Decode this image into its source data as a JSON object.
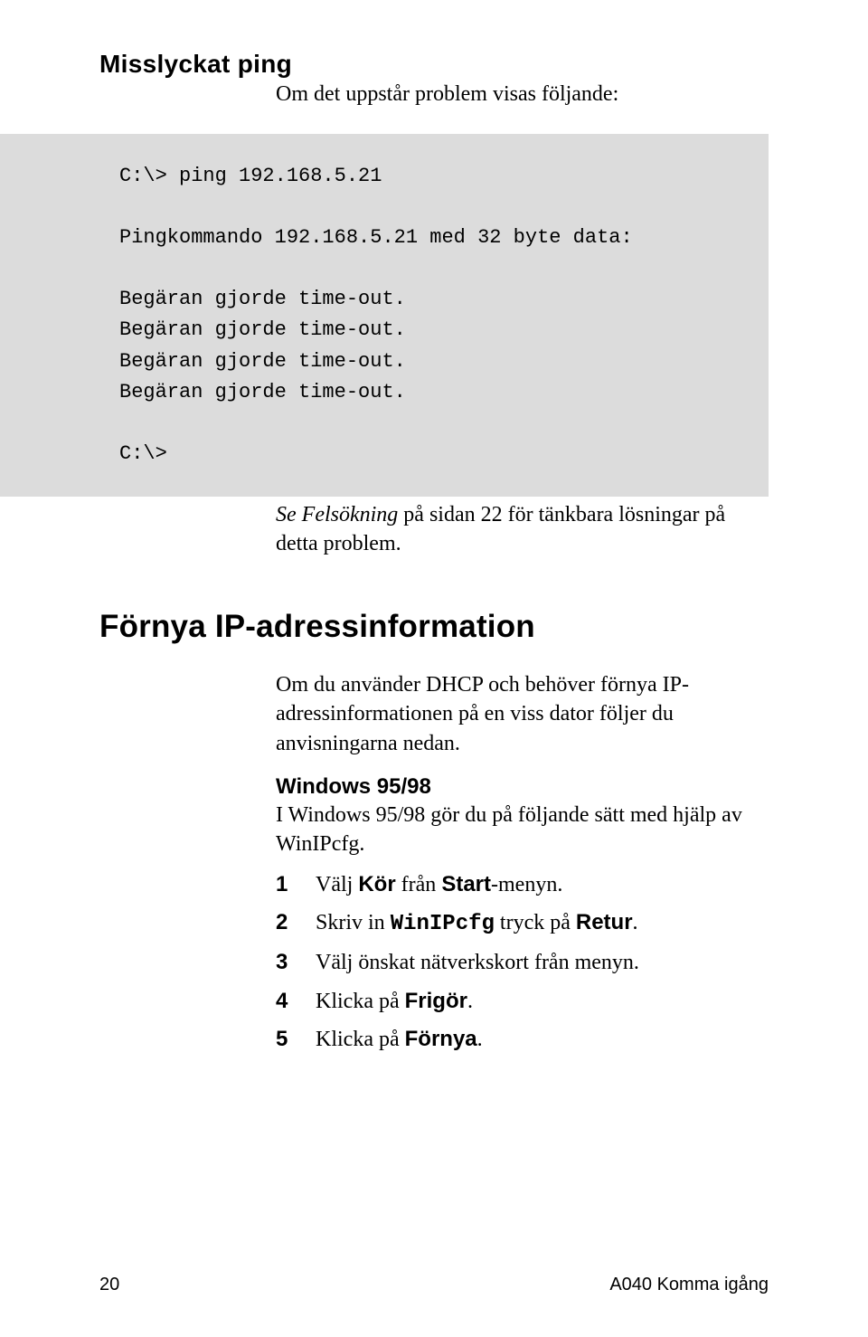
{
  "section1": {
    "heading": "Misslyckat ping",
    "intro": "Om det uppstår problem visas följande:"
  },
  "code": {
    "line1": "C:\\> ping 192.168.5.21",
    "line2": "Pingkommando 192.168.5.21 med 32 byte data:",
    "line3": "Begäran gjorde time-out.",
    "line4": "Begäran gjorde time-out.",
    "line5": "Begäran gjorde time-out.",
    "line6": "Begäran gjorde time-out.",
    "line7": "C:\\>"
  },
  "postcode": {
    "pre": "Se ",
    "italic": "Felsökning",
    "post": " på sidan 22 för tänkbara lösningar på detta problem."
  },
  "section2": {
    "heading": "Förnya IP-adressinformation",
    "para": "Om du använder DHCP och behöver förnya IP-adressinformationen på en viss dator följer du anvisningarna nedan.",
    "subheading": "Windows 95/98",
    "subpara": "I Windows 95/98 gör du på följande sätt med hjälp av WinIPcfg."
  },
  "steps": [
    {
      "num": "1",
      "pre": "Välj ",
      "b1": "Kör",
      "mid": " från ",
      "b2": "Start",
      "post": "-menyn."
    },
    {
      "num": "2",
      "pre": "Skriv in ",
      "mono": "WinIPcfg",
      "mid": " tryck på ",
      "b1": "Retur",
      "post": "."
    },
    {
      "num": "3",
      "pre": "Välj önskat nätverkskort från menyn.",
      "b1": "",
      "mid": "",
      "post": ""
    },
    {
      "num": "4",
      "pre": "Klicka på ",
      "b1": "Frigör",
      "mid": "",
      "post": "."
    },
    {
      "num": "5",
      "pre": "Klicka på ",
      "b1": "Förnya",
      "mid": "",
      "post": "."
    }
  ],
  "footer": {
    "page": "20",
    "label": "A040 Komma igång"
  }
}
